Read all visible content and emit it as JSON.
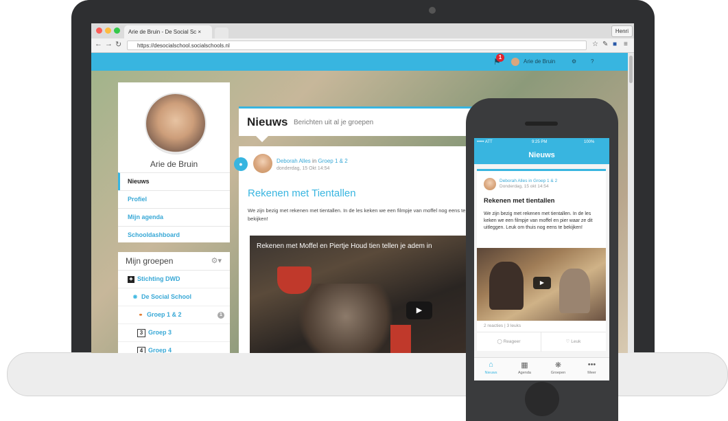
{
  "browser": {
    "tab_title": "Arie de Bruin - De Social Sc ×",
    "user_button": "Henri",
    "url": "https://desocialschool.socialschools.nl"
  },
  "topnav": {
    "notification_count": "1",
    "user_name": "Arie de Bruin",
    "settings_label": "⚙",
    "help_label": "?"
  },
  "profile": {
    "name": "Arie de Bruin",
    "menu": [
      "Nieuws",
      "Profiel",
      "Mijn agenda",
      "Schooldashboard"
    ]
  },
  "groups": {
    "title": "Mijn groepen",
    "items": [
      "Stichting DWD",
      "De Social School",
      "Groep 1 & 2",
      "Groep 3",
      "Groep 4"
    ],
    "badge": "1"
  },
  "news": {
    "title": "Nieuws",
    "subtitle": "Berichten uit al je groepen"
  },
  "post": {
    "author": "Deborah Alles",
    "in_label": "in",
    "group": "Groep 1 & 2",
    "date": "donderdag, 15 Okt 14:54",
    "title": "Rekenen met Tientallen",
    "text": "We zijn bezig met rekenen met tientallen. In de les keken we een filmpje van moffel nog eens te bekijken!",
    "video_title": "Rekenen met Moffel en Piertje Houd tien tellen je adem in"
  },
  "phone": {
    "status_carrier": "••••• ATT",
    "status_time": "9:25 PM",
    "status_battery": "100%",
    "nav_title": "Nieuws",
    "author_line": "Deborah Alles in Groep 1 & 2",
    "date": "Donderdag, 15 okt 14:54",
    "title": "Rekenen met tientallen",
    "text": "We zijn bezig met rekenen met tientallen. In de les keken we een filmpje van moffel en pier waar ze dit uitleggen. Leuk om thuis nog eens te bekijken!",
    "stats": "2 reacties | 3 leuks",
    "reply_label": "Reageer",
    "like_label": "Leuk",
    "tabs": [
      "Nieuws",
      "Agenda",
      "Groepen",
      "Meer"
    ]
  }
}
